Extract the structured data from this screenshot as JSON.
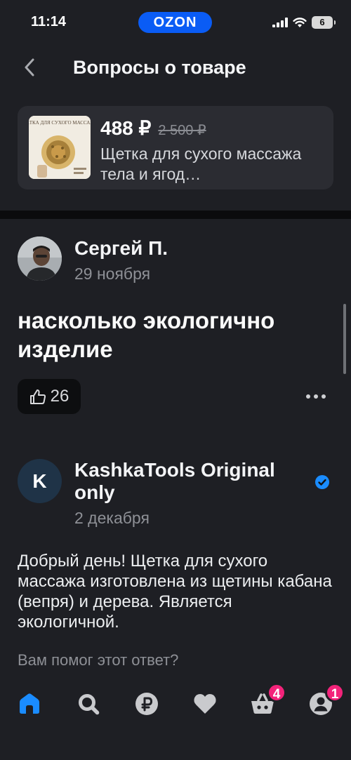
{
  "status_bar": {
    "time": "11:14",
    "battery": "6",
    "app_badge": "OZON"
  },
  "header": {
    "title": "Вопросы о товаре"
  },
  "product": {
    "price": "488 ₽",
    "old_price": "2 500 ₽",
    "name": "Щетка для сухого массажа тела и ягод…",
    "thumb_text": "ЩЕТКА ДЛЯ СУХОГО МАССАЖА"
  },
  "question": {
    "author": "Сергей П.",
    "date": "29 ноября",
    "text": "насколько экологично изделие",
    "likes": "26"
  },
  "answer": {
    "avatar_letter": "K",
    "author": "KashkaTools Original only",
    "date": "2 декабря",
    "text": "Добрый день! Щетка для сухого массажа изготовлена из щетины кабана (вепря) и дерева. Является экологичной.",
    "helpful_prompt": "Вам помог этот ответ?"
  },
  "bottom_nav": {
    "items": [
      "home-icon",
      "search-icon",
      "ruble-icon",
      "heart-icon",
      "cart-icon",
      "profile-icon"
    ],
    "cart_badge": "4",
    "profile_badge": "1"
  },
  "colors": {
    "accent": "#0a5cf5",
    "badge": "#f3237a",
    "verified": "#1a8cff",
    "background": "#1e1f24"
  }
}
